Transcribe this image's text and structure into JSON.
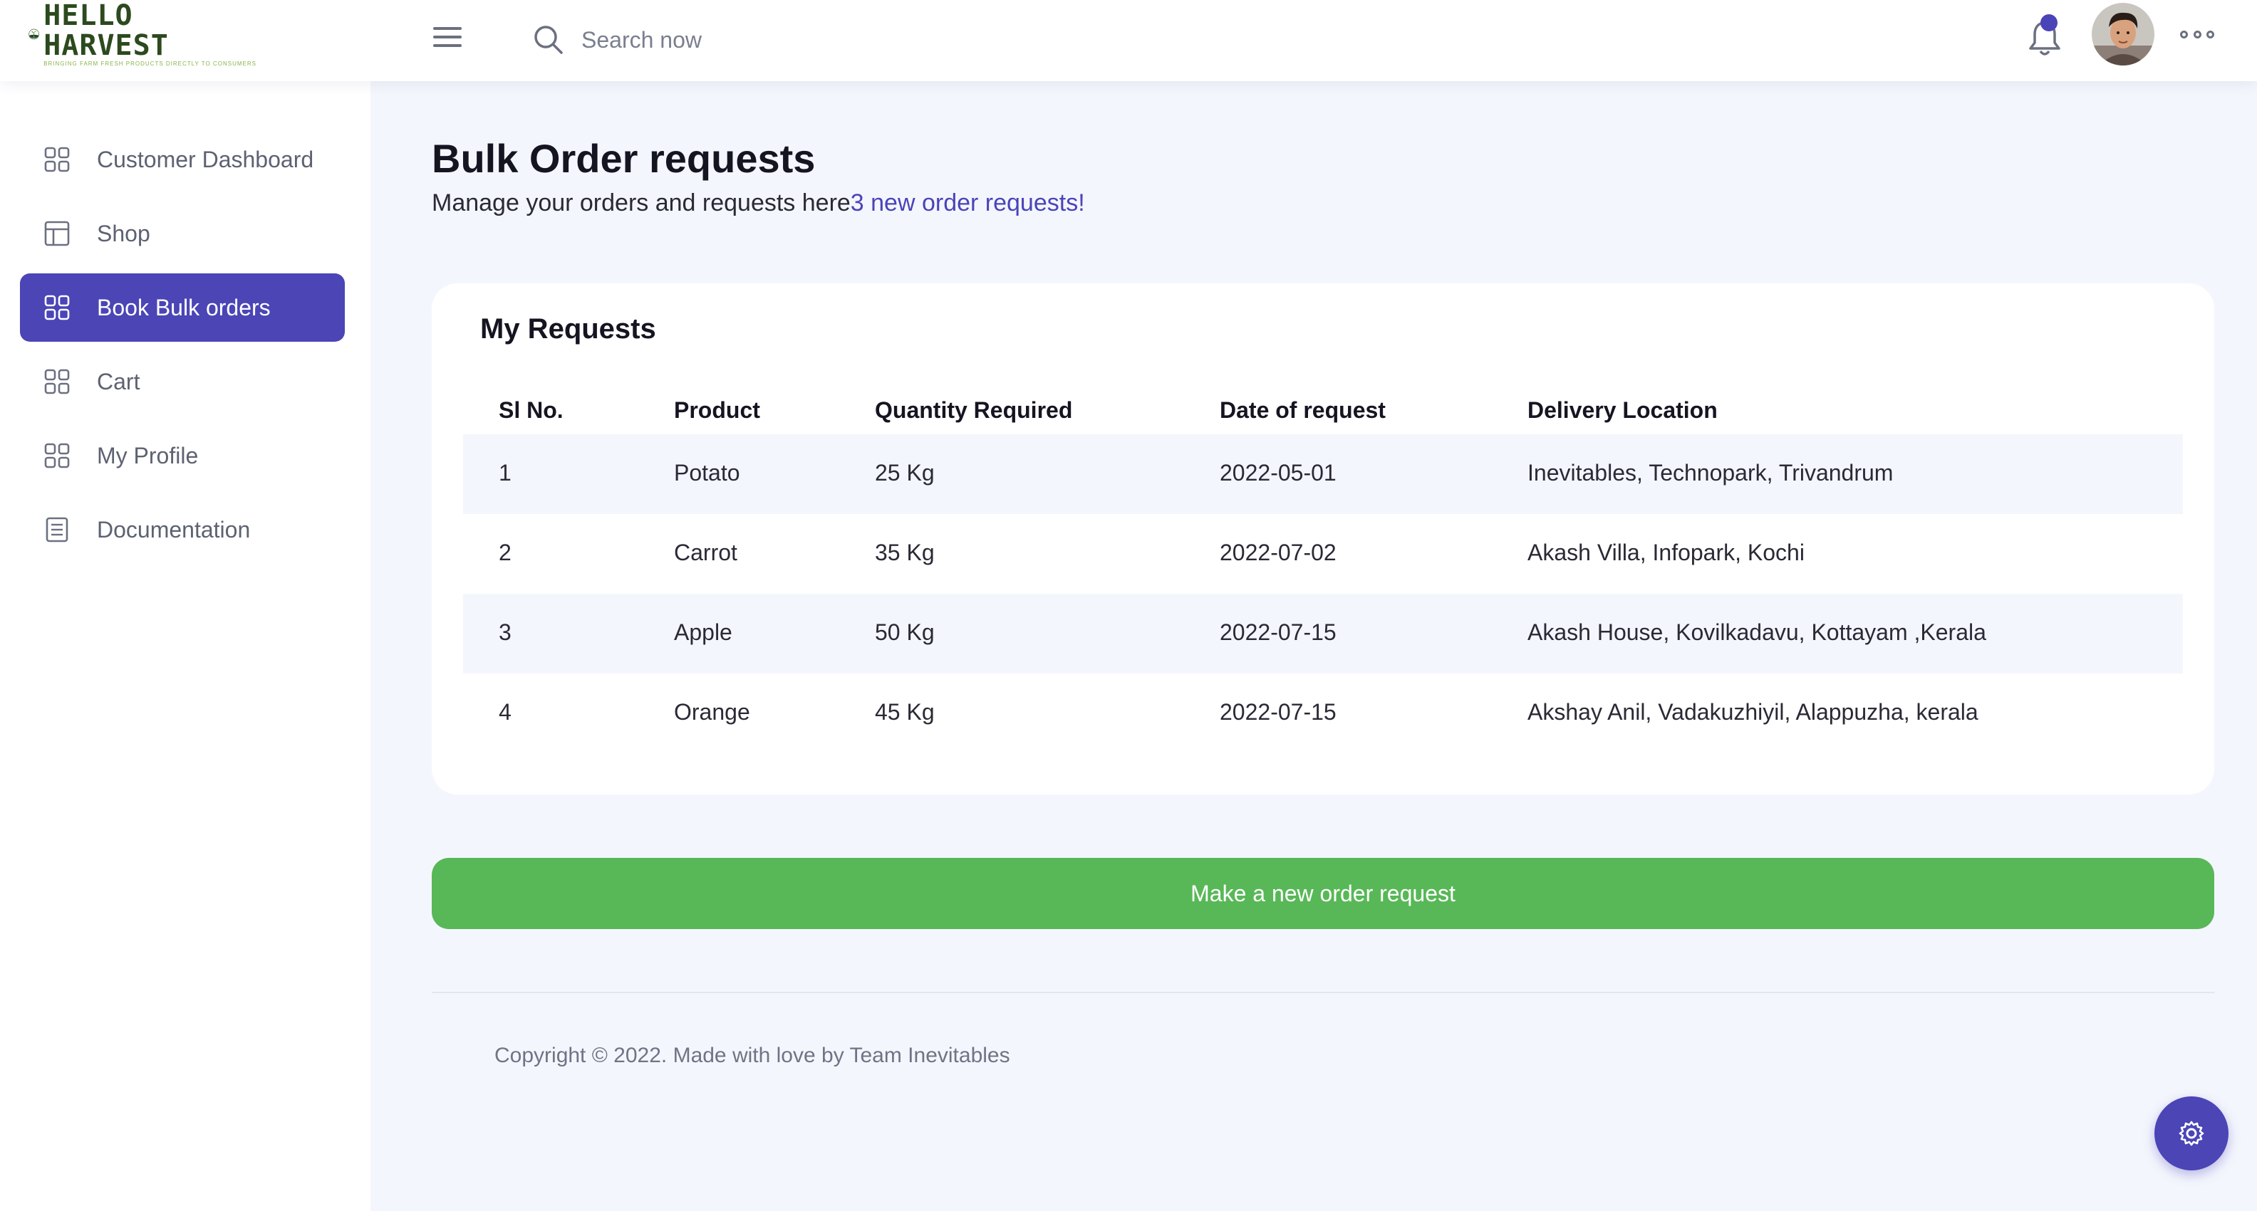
{
  "brand": {
    "name": "HELLO HARVEST",
    "tagline": "BRINGING FARM FRESH PRODUCTS DIRECTLY TO CONSUMERS"
  },
  "header": {
    "search_placeholder": "Search now",
    "notification_dot_color": "#4a44b8"
  },
  "sidebar": {
    "items": [
      {
        "label": "Customer Dashboard",
        "icon": "grid-icon",
        "active": false
      },
      {
        "label": "Shop",
        "icon": "layout-icon",
        "active": false
      },
      {
        "label": "Book Bulk orders",
        "icon": "grid-icon",
        "active": true
      },
      {
        "label": "Cart",
        "icon": "grid-icon",
        "active": false
      },
      {
        "label": "My Profile",
        "icon": "grid-icon",
        "active": false
      },
      {
        "label": "Documentation",
        "icon": "document-icon",
        "active": false
      }
    ]
  },
  "main": {
    "title": "Bulk Order requests",
    "subtitle": "Manage your orders and requests here",
    "subtitle_link": "3 new order requests!"
  },
  "requests": {
    "title": "My Requests",
    "columns": [
      "Sl No.",
      "Product",
      "Quantity Required",
      "Date of request",
      "Delivery Location"
    ],
    "rows": [
      [
        "1",
        "Potato",
        "25 Kg",
        "2022-05-01",
        "Inevitables, Technopark, Trivandrum"
      ],
      [
        "2",
        "Carrot",
        "35 Kg",
        "2022-07-02",
        "Akash Villa, Infopark, Kochi"
      ],
      [
        "3",
        "Apple",
        "50 Kg",
        "2022-07-15",
        "Akash House, Kovilkadavu, Kottayam ,Kerala"
      ],
      [
        "4",
        "Orange",
        "45 Kg",
        "2022-07-15",
        "Akshay Anil, Vadakuzhiyil, Alappuzha, kerala"
      ]
    ]
  },
  "actions": {
    "new_request_label": "Make a new order request"
  },
  "footer": {
    "copyright": "Copyright © 2022. Made with love by Team Inevitables"
  },
  "colors": {
    "accent": "#4b45b6",
    "button_green": "#58b857",
    "page_bg": "#f4f6fd"
  }
}
